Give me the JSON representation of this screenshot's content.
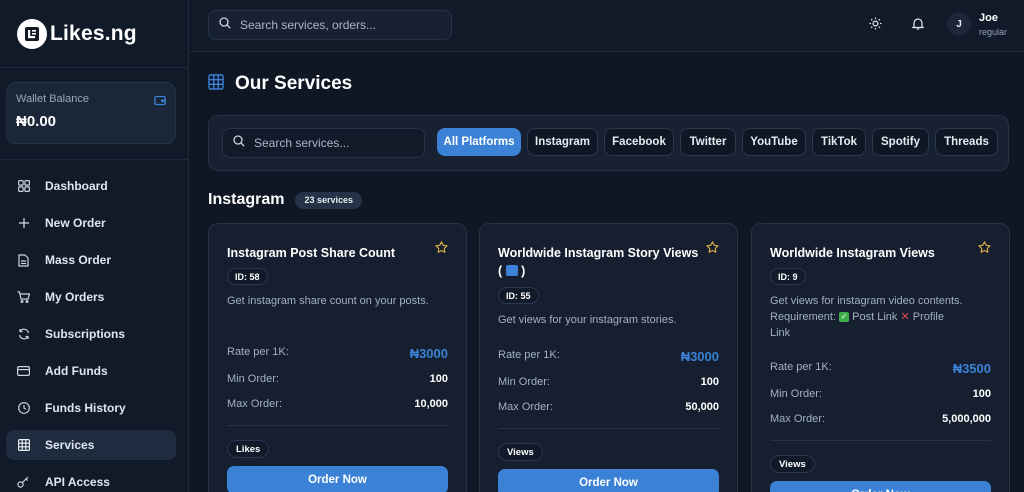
{
  "brand": {
    "name": "Likes.ng"
  },
  "wallet": {
    "label": "Wallet Balance",
    "amount": "₦0.00"
  },
  "nav": [
    {
      "label": "Dashboard",
      "icon": "dashboard-icon"
    },
    {
      "label": "New Order",
      "icon": "plus-icon"
    },
    {
      "label": "Mass Order",
      "icon": "document-icon"
    },
    {
      "label": "My Orders",
      "icon": "cart-icon"
    },
    {
      "label": "Subscriptions",
      "icon": "refresh-icon"
    },
    {
      "label": "Add Funds",
      "icon": "card-icon"
    },
    {
      "label": "Funds History",
      "icon": "clock-icon"
    },
    {
      "label": "Services",
      "icon": "grid-icon",
      "active": true
    },
    {
      "label": "API Access",
      "icon": "key-icon"
    }
  ],
  "header": {
    "search_placeholder": "Search services, orders...",
    "user": {
      "initial": "J",
      "name": "Joe",
      "role": "regular"
    }
  },
  "page": {
    "title": "Our Services"
  },
  "filters": {
    "search_placeholder": "Search services...",
    "platforms": [
      "All Platforms",
      "Instagram",
      "Facebook",
      "Twitter",
      "YouTube",
      "TikTok",
      "Spotify",
      "Threads"
    ],
    "active": "All Platforms"
  },
  "section": {
    "title": "Instagram",
    "count": "23 services"
  },
  "labels": {
    "rate": "Rate per 1K:",
    "min": "Min Order:",
    "max": "Max Order:",
    "order_button": "Order Now"
  },
  "cards": [
    {
      "title": "Instagram Post Share Count",
      "id": "ID: 58",
      "description": "Get instagram share count on your posts.",
      "rate": "₦3000",
      "min": "100",
      "max": "10,000",
      "tag": "Likes"
    },
    {
      "title": "Worldwide Instagram Story Views",
      "title_suffix_open": "(",
      "title_suffix_close": ")",
      "id": "ID: 55",
      "description": "Get views for your instagram stories.",
      "rate": "₦3000",
      "min": "100",
      "max": "50,000",
      "tag": "Views"
    },
    {
      "title": "Worldwide Instagram Views",
      "id": "ID: 9",
      "description_line1": "Get views for instagram video contents.",
      "description_req": "Requirement:",
      "description_ok": "Post Link",
      "description_no": "Profile",
      "description_no_cont": "Link",
      "rate": "₦3500",
      "min": "100",
      "max": "5,000,000",
      "tag": "Views"
    }
  ],
  "colors": {
    "accent": "#3b82d6",
    "background": "#0f1624",
    "star": "#e0b04a"
  }
}
